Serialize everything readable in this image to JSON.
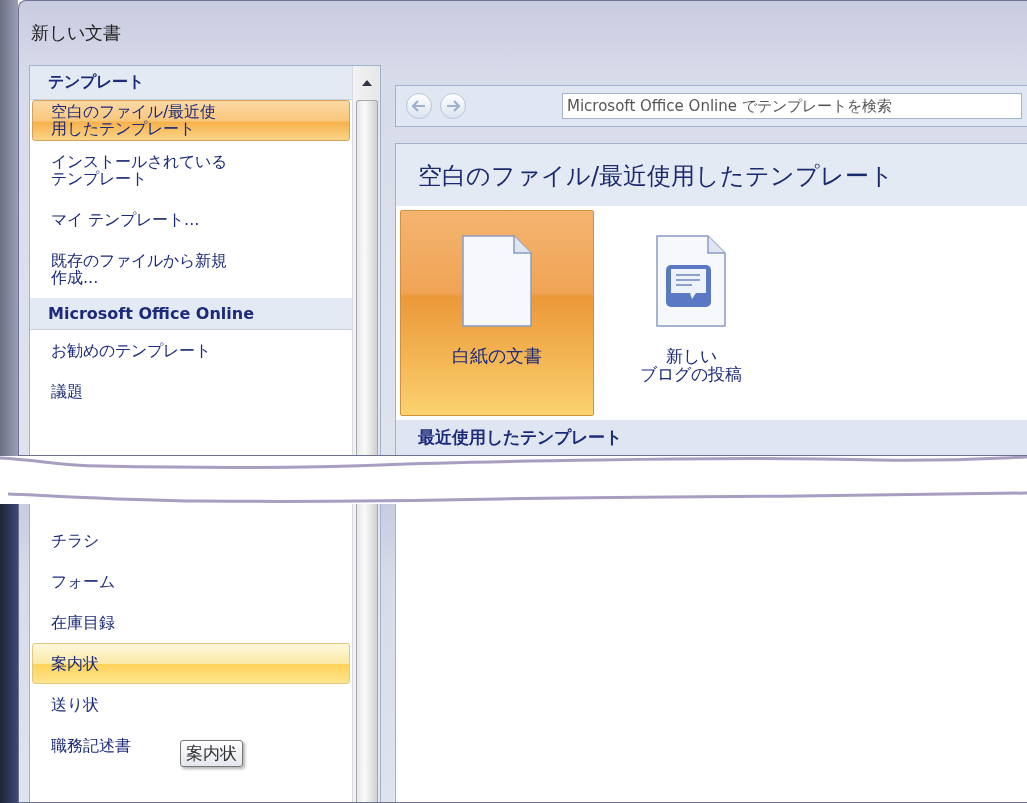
{
  "window": {
    "title": "新しい文書"
  },
  "sidebar_top": [
    {
      "kind": "header",
      "label": "テンプレート"
    },
    {
      "kind": "item",
      "label": "空白のファイル/最近使用したテンプレート",
      "selected": true,
      "hovered": false
    },
    {
      "kind": "item",
      "label": "インストールされているテンプレート",
      "selected": false,
      "hovered": false
    },
    {
      "kind": "item",
      "label": "マイ テンプレート...",
      "selected": false,
      "hovered": false
    },
    {
      "kind": "item",
      "label": "既存のファイルから新規作成...",
      "selected": false,
      "hovered": false
    },
    {
      "kind": "header",
      "label": "Microsoft Office Online"
    },
    {
      "kind": "item",
      "label": "お勧めのテンプレート",
      "selected": false,
      "hovered": false
    },
    {
      "kind": "item",
      "label": "議題",
      "selected": false,
      "hovered": false
    }
  ],
  "sidebar_bottom": [
    {
      "kind": "item",
      "label": "チラシ",
      "selected": false,
      "hovered": false
    },
    {
      "kind": "item",
      "label": "フォーム",
      "selected": false,
      "hovered": false
    },
    {
      "kind": "item",
      "label": "在庫目録",
      "selected": false,
      "hovered": false
    },
    {
      "kind": "item",
      "label": "案内状",
      "selected": false,
      "hovered": true
    },
    {
      "kind": "item",
      "label": "送り状",
      "selected": false,
      "hovered": false
    },
    {
      "kind": "item",
      "label": "職務記述書",
      "selected": false,
      "hovered": false
    }
  ],
  "tooltip": {
    "text": "案内状"
  },
  "nav": {
    "back": {
      "disabled": true
    },
    "forward": {
      "disabled": true
    }
  },
  "search": {
    "placeholder": "Microsoft Office Online でテンプレートを検索"
  },
  "main": {
    "heading": "空白のファイル/最近使用したテンプレート",
    "tiles": [
      {
        "kind": "blank",
        "label_lines": [
          "白紙の文書"
        ],
        "selected": true
      },
      {
        "kind": "blog",
        "label_lines": [
          "新しい",
          "ブログの投稿"
        ],
        "selected": false
      }
    ],
    "section": "最近使用したテンプレート"
  }
}
